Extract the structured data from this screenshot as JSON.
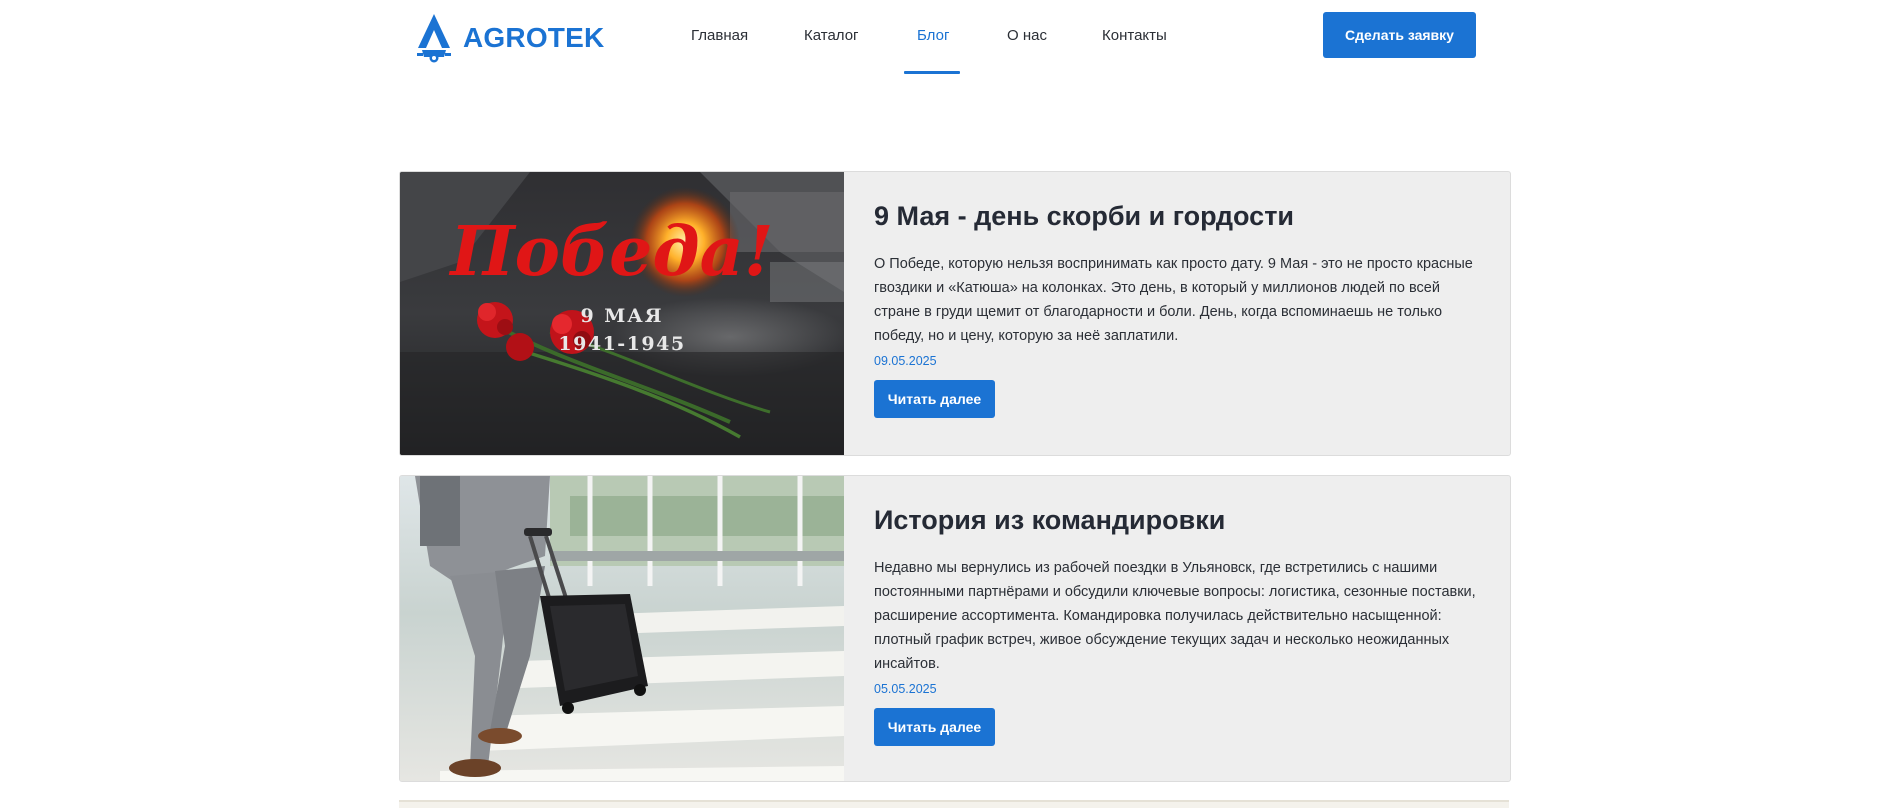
{
  "header": {
    "logo_text": "AGROTEK",
    "nav": [
      {
        "label": "Главная",
        "active": false
      },
      {
        "label": "Каталог",
        "active": false
      },
      {
        "label": "Блог",
        "active": true
      },
      {
        "label": "О нас",
        "active": false
      },
      {
        "label": "Контакты",
        "active": false
      }
    ],
    "cta_label": "Сделать заявку"
  },
  "posts": [
    {
      "image_text_main": "Победа!",
      "image_text_date": "9 МАЯ",
      "image_text_years": "1941-1945",
      "title": "9 Мая - день скорби и гордости",
      "excerpt": "О Победе, которую нельзя воспринимать как просто дату. 9 Мая - это не просто красные гвоздики и «Катюша» на колонках. Это день, в который у миллионов людей по всей стране в груди щемит от благодарности и боли. День, когда вспоминаешь не только победу, но и цену, которую за неё заплатили.",
      "date": "09.05.2025",
      "button_label": "Читать далее"
    },
    {
      "title": "История из командировки",
      "excerpt": "Недавно мы вернулись из рабочей поездки в Ульяновск, где встретились с нашими постоянными партнёрами и обсудили ключевые вопросы: логистика, сезонные поставки, расширение ассортимента. Командировка получилась действительно насыщенной: плотный график встреч, живое обсуждение текущих задач и несколько неожиданных инсайтов.",
      "date": "05.05.2025",
      "button_label": "Читать далее"
    }
  ],
  "colors": {
    "accent": "#1b73d3",
    "card_bg": "#eeeeee",
    "title": "#252a35",
    "victory_red": "#e01616"
  }
}
